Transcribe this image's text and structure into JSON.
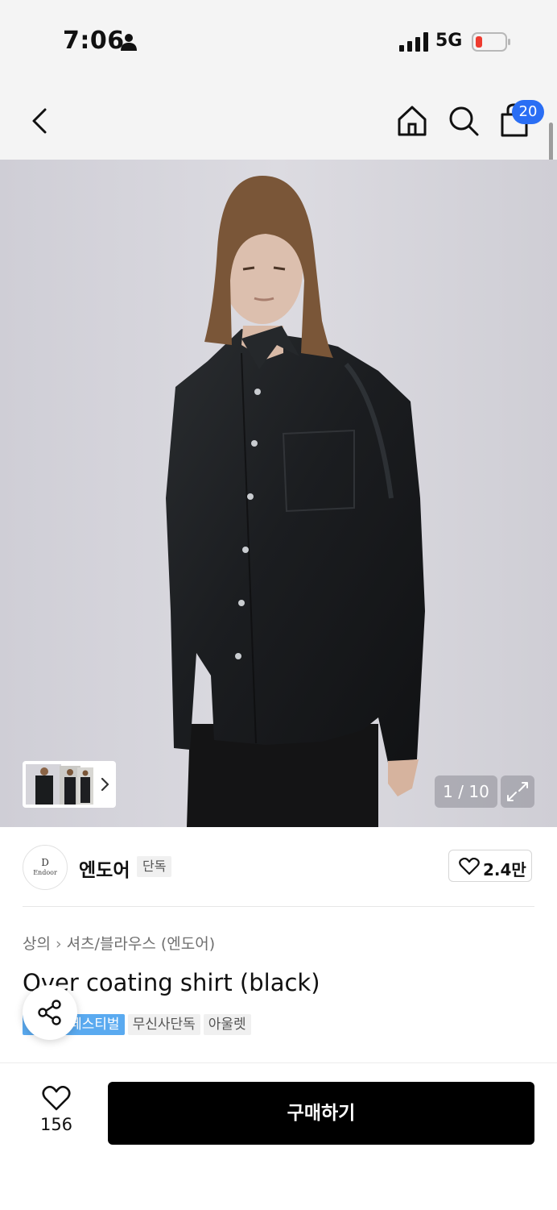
{
  "status_bar": {
    "time": "7:06",
    "network": "5G"
  },
  "nav": {
    "cart_count": "20"
  },
  "gallery": {
    "counter": "1 / 10"
  },
  "brand": {
    "logo_mark": "D",
    "logo_wordmark": "Endoor",
    "name": "엔도어",
    "tag": "단독",
    "likes": "2.4만"
  },
  "breadcrumb": {
    "level1": "상의",
    "level2": "셔츠/블라우스 (엔도어)"
  },
  "product": {
    "title": "Over coating shirt (black)"
  },
  "tags": [
    "페스티벌",
    "무신사단독",
    "아울렛"
  ],
  "bottom": {
    "wish_count": "156",
    "buy_label": "구매하기"
  },
  "colors": {
    "accent_blue": "#2a6ef4",
    "tag_blue": "#5aaaf0",
    "buy_button": "#000000"
  },
  "icons": [
    "person-icon",
    "signal-icon",
    "battery-icon",
    "back-icon",
    "home-icon",
    "search-icon",
    "cart-icon",
    "chevron-right-icon",
    "expand-icon",
    "heart-icon",
    "share-icon"
  ]
}
